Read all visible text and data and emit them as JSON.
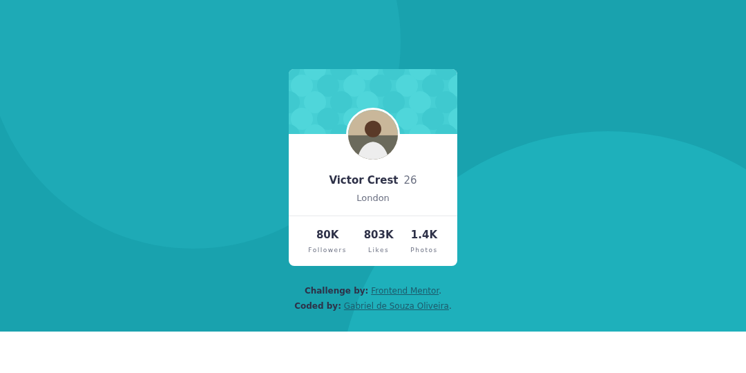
{
  "profile": {
    "name": "Victor Crest",
    "age": "26",
    "city": "London",
    "stats": [
      {
        "value": "80K",
        "label": "Followers"
      },
      {
        "value": "803K",
        "label": "Likes"
      },
      {
        "value": "1.4K",
        "label": "Photos"
      }
    ]
  },
  "attribution": [
    {
      "label": "Challenge by:",
      "link": "Frontend Mentor",
      "end": "."
    },
    {
      "label": "Coded by:",
      "link": "Gabriel de Souza Oliveira",
      "end": "."
    }
  ]
}
